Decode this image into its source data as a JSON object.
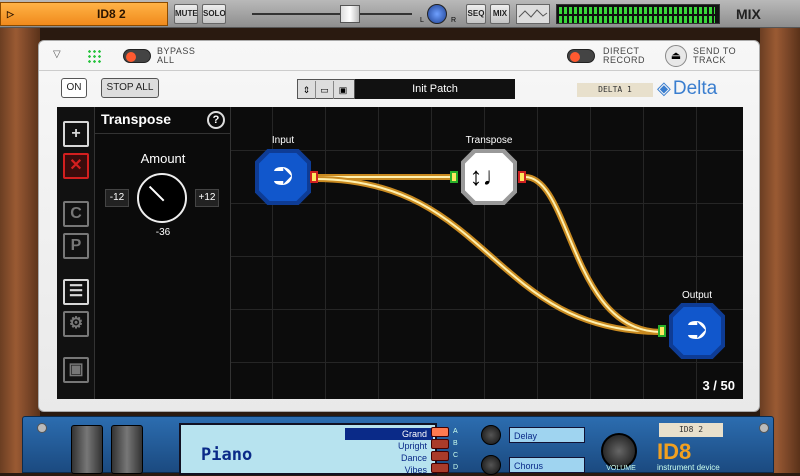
{
  "mixer": {
    "track_name": "ID8 2",
    "play_icon": "▷",
    "mute_label": "MUTE",
    "solo_label": "SOLO",
    "pan_left": "L",
    "pan_right": "R",
    "seq_label": "SEQ",
    "mix_btn_label": "MIX",
    "mix_title": "MIX"
  },
  "device": {
    "bypass_label_1": "BYPASS",
    "bypass_label_2": "ALL",
    "direct_label_1": "DIRECT",
    "direct_label_2": "RECORD",
    "send_label_1": "SEND TO",
    "send_label_2": "TRACK",
    "on_label": "ON",
    "stop_all_label": "STOP ALL",
    "patch_name": "Init Patch",
    "tape_label": "DELTA 1",
    "brand": "Delta",
    "accent_color": "#3a7ecf"
  },
  "editor": {
    "tools": [
      {
        "name": "add-icon",
        "glyph": "+"
      },
      {
        "name": "delete-icon",
        "glyph": "✕"
      },
      {
        "name": "copy-icon",
        "glyph": "C"
      },
      {
        "name": "paste-icon",
        "glyph": "P"
      },
      {
        "name": "list-icon",
        "glyph": "☰"
      },
      {
        "name": "gear-icon",
        "glyph": "⚙"
      },
      {
        "name": "window-icon",
        "glyph": "▣"
      }
    ],
    "param_title": "Transpose",
    "help_glyph": "?",
    "amount_label": "Amount",
    "min_label": "-12",
    "max_label": "+12",
    "amount_value": "-36",
    "nodes": {
      "input_label": "Input",
      "transpose_label": "Transpose",
      "output_label": "Output"
    },
    "counter": "3 / 50"
  },
  "instrument": {
    "patch_name": "Piano",
    "options": [
      "Grand",
      "Upright",
      "Dance",
      "Vibes"
    ],
    "selected_option": "Grand",
    "slot_letters": [
      "A",
      "B",
      "C",
      "D"
    ],
    "fx1": "Delay",
    "fx2": "Chorus",
    "volume_label": "VOLUME",
    "tape_label": "ID8 2",
    "logo": "ID8",
    "logo_sub": "instrument device"
  }
}
